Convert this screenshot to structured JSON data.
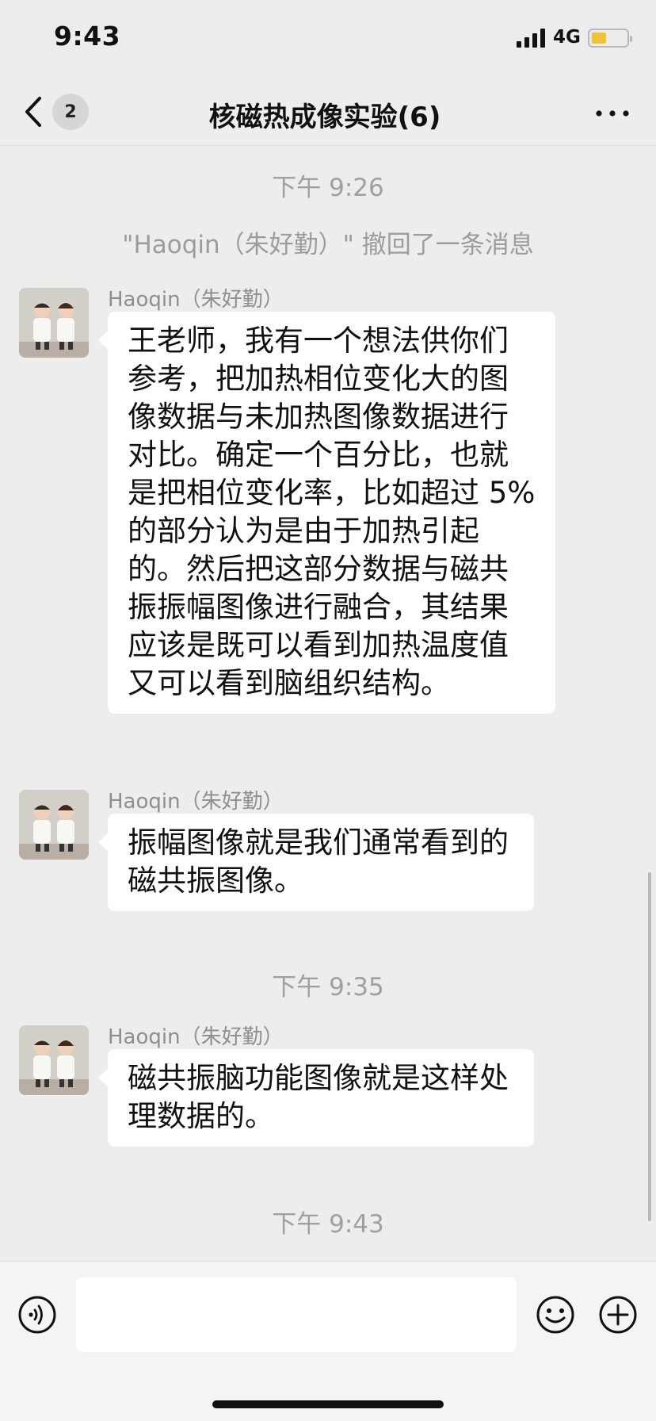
{
  "status_bar": {
    "time": "9:43",
    "network": "4G",
    "battery_level": 0.4
  },
  "nav": {
    "unread_count": "2",
    "title": "核磁热成像实验(6)"
  },
  "messages_area": {
    "time_1": "下午 9:26",
    "recall_notice": "\"Haoqin（朱好勤）\" 撤回了一条消息",
    "time_2": "下午 9:35",
    "time_3": "下午 9:43",
    "messages": [
      {
        "sender": "Haoqin（朱好勤）",
        "text": "王老师，我有一个想法供你们参考，把加热相位变化大的图像数据与未加热图像数据进行对比。确定一个百分比，也就是把相位变化率，比如超过 5% 的部分认为是由于加热引起的。然后把这部分数据与磁共振振幅图像进行融合，其结果应该是既可以看到加热温度值又可以看到脑组织结构。"
      },
      {
        "sender": "Haoqin（朱好勤）",
        "text": "振幅图像就是我们通常看到的磁共振图像。"
      },
      {
        "sender": "Haoqin（朱好勤）",
        "text": "磁共振脑功能图像就是这样处理数据的。"
      }
    ]
  },
  "input_bar": {
    "message_value": "",
    "message_placeholder": ""
  },
  "colors": {
    "background": "#ededed",
    "bubble": "#ffffff",
    "battery_fill": "#f1c232",
    "muted_text": "#9c9c9c"
  },
  "icons": {
    "back": "back-chevron-icon",
    "more": "more-dots-icon",
    "voice": "voice-icon",
    "emoji": "emoji-icon",
    "add": "add-icon",
    "signal": "signal-icon",
    "battery": "battery-icon"
  }
}
